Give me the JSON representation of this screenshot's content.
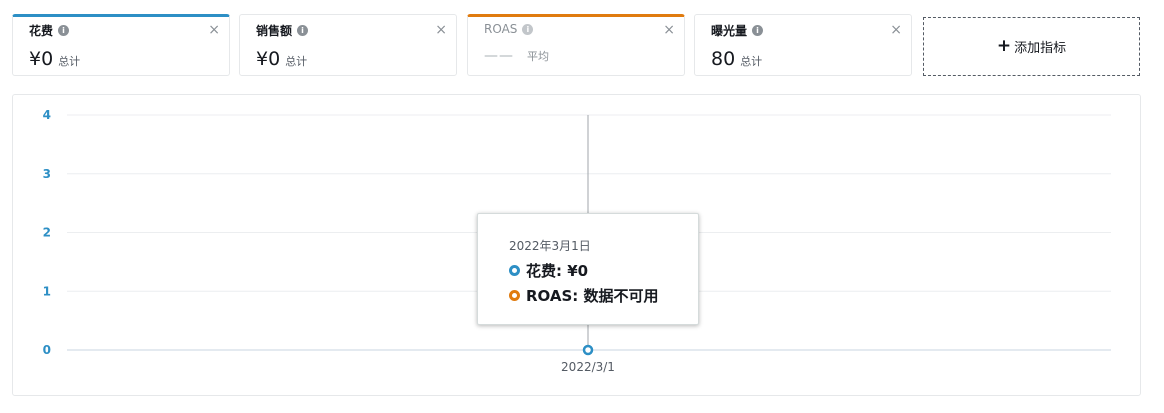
{
  "metrics": [
    {
      "title": "花费",
      "value": "¥0",
      "label": "总计",
      "close": "×"
    },
    {
      "title": "销售额",
      "value": "¥0",
      "label": "总计",
      "close": "×"
    },
    {
      "title": "ROAS",
      "value": "——",
      "label": "平均",
      "close": "×"
    },
    {
      "title": "曝光量",
      "value": "80",
      "label": "总计",
      "close": "×"
    }
  ],
  "add_metric": {
    "plus": "+",
    "label": "添加指标"
  },
  "colors": {
    "spend": "#2d8fc5",
    "roas": "#e07b0f"
  },
  "chart_data": {
    "type": "line",
    "x": [
      "2022/3/1"
    ],
    "y_ticks": [
      "0",
      "1",
      "2",
      "3",
      "4"
    ],
    "ylim": [
      0,
      4
    ],
    "grid": true,
    "series": [
      {
        "name": "花费",
        "values": [
          0
        ],
        "color": "#2d8fc5"
      },
      {
        "name": "ROAS",
        "values": [
          null
        ],
        "color": "#e07b0f"
      }
    ]
  },
  "tooltip": {
    "date": "2022年3月1日",
    "rows": [
      {
        "text": "花费: ¥0"
      },
      {
        "text": "ROAS: 数据不可用"
      }
    ]
  }
}
